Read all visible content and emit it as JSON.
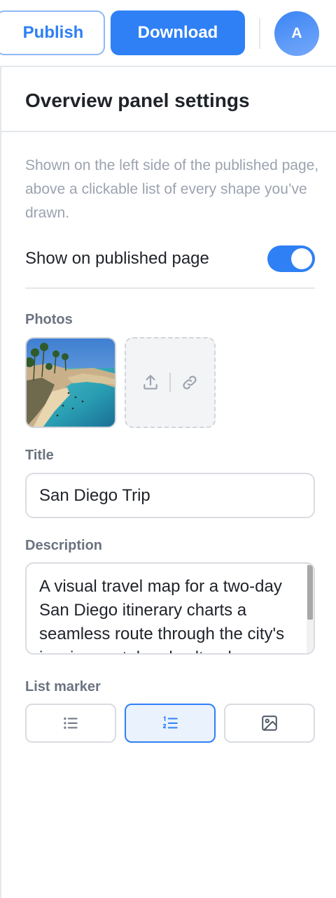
{
  "topbar": {
    "publish_label": "Publish",
    "download_label": "Download",
    "avatar_initial": "A"
  },
  "panel": {
    "title": "Overview panel settings",
    "description": "Shown on the left side of the published page, above a clickable list of every shape you’ve drawn.",
    "toggle": {
      "label": "Show on published page",
      "on": true
    },
    "photos": {
      "label": "Photos",
      "count": 1
    },
    "title_field": {
      "label": "Title",
      "value": "San Diego Trip"
    },
    "description_field": {
      "label": "Description",
      "value": "A visual travel map for a two-day San Diego itinerary charts a seamless route through the city's iconic coastal and cultural gems"
    },
    "list_marker": {
      "label": "List marker",
      "options": [
        "bullet-list-icon",
        "numbered-list-icon",
        "image-icon"
      ],
      "selected": "numbered-list-icon"
    }
  },
  "colors": {
    "accent": "#2f80f5",
    "accent_light_bg": "#eaf2fe",
    "muted_text": "#9ca3af",
    "label_text": "#6b7280",
    "border": "#d9dce1"
  }
}
